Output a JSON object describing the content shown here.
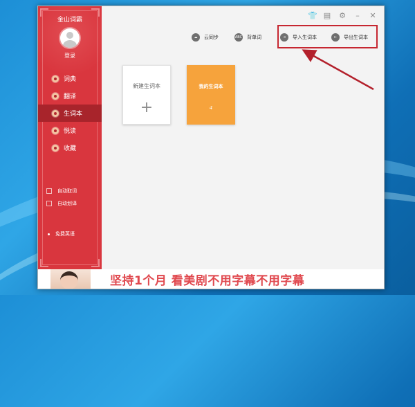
{
  "app": {
    "title": "金山词霸"
  },
  "user": {
    "login_label": "登录"
  },
  "sidebar": {
    "items": [
      {
        "label": "词典",
        "active": false
      },
      {
        "label": "翻译",
        "active": false
      },
      {
        "label": "生词本",
        "active": true
      },
      {
        "label": "悦读",
        "active": false
      },
      {
        "label": "收藏",
        "active": false
      }
    ],
    "checks": [
      {
        "label": "自动取词"
      },
      {
        "label": "自动划译"
      }
    ],
    "free_label": "免费英语"
  },
  "toolbar": {
    "cloud_sync": "云同步",
    "recite_words": "背单词",
    "import_wordbook": "导入生词本",
    "export_wordbook": "导出生词本",
    "recite_icon_text": "ABC"
  },
  "cards": {
    "new_label": "新建生词本",
    "new_plus": "+",
    "mine_label": "我的生词本",
    "mine_count": "4"
  },
  "banner": {
    "text": "坚持1个月 看美剧不用字幕不用字幕"
  },
  "colors": {
    "sidebar": "#d9363e",
    "active": "#a8242b",
    "accent_card": "#f6a33c",
    "highlight": "#c62630"
  }
}
